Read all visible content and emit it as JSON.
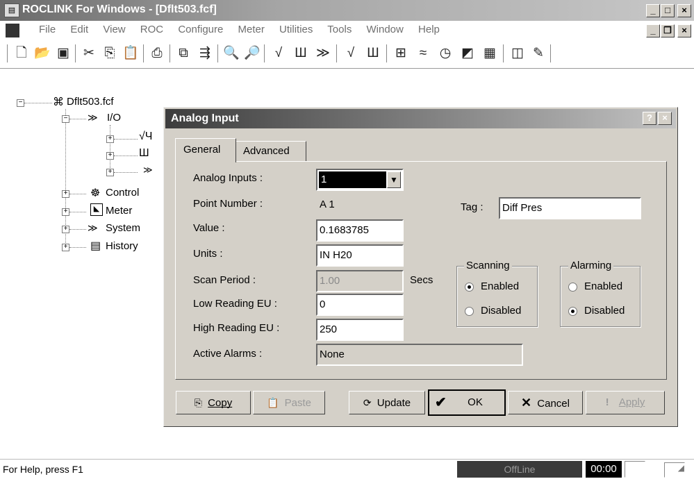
{
  "app": {
    "title": "ROCLINK For Windows - [Dflt503.fcf]",
    "menu": [
      "File",
      "Edit",
      "View",
      "ROC",
      "Configure",
      "Meter",
      "Utilities",
      "Tools",
      "Window",
      "Help"
    ]
  },
  "tree": {
    "root": "Dflt503.fcf",
    "io": "I/O",
    "control": "Control",
    "meter": "Meter",
    "system": "System",
    "history": "History"
  },
  "dialog": {
    "title": "Analog Input",
    "help_btn": "?",
    "close_btn": "×",
    "tabs": [
      "General",
      "Advanced"
    ],
    "labels": {
      "analog_inputs": "Analog Inputs :",
      "point_number": "Point Number :",
      "value": "Value :",
      "units": "Units :",
      "scan_period": "Scan Period :",
      "low_reading": "Low Reading EU :",
      "high_reading": "High Reading EU :",
      "active_alarms": "Active Alarms :",
      "tag": "Tag :",
      "secs": "Secs"
    },
    "values": {
      "analog_inputs": "1",
      "point_number": "A 1",
      "value": "0.1683785",
      "units": "IN H20",
      "scan_period": "1.00",
      "low_reading": "0",
      "high_reading": "250",
      "active_alarms": "None",
      "tag": "Diff Pres"
    },
    "scanning": {
      "title": "Scanning",
      "enabled": "Enabled",
      "disabled": "Disabled",
      "selected": "Enabled"
    },
    "alarming": {
      "title": "Alarming",
      "enabled": "Enabled",
      "disabled": "Disabled",
      "selected": "Disabled"
    },
    "buttons": {
      "copy": "Copy",
      "paste": "Paste",
      "update": "Update",
      "ok": "OK",
      "cancel": "Cancel",
      "apply": "Apply"
    }
  },
  "status": {
    "help": "For Help, press F1",
    "mode": "OffLine",
    "time": "00:00"
  }
}
